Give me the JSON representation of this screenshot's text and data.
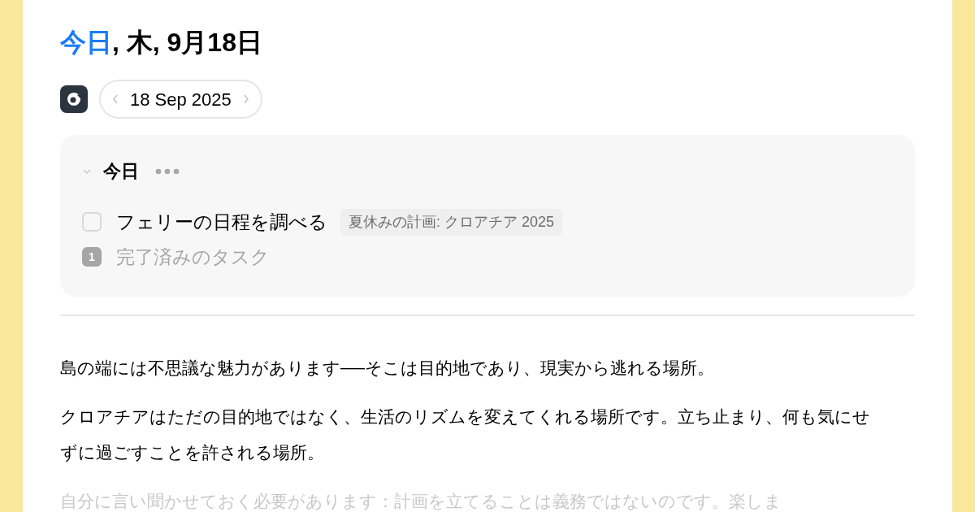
{
  "header": {
    "title_highlight": "今日",
    "title_rest": ", 木, 9月18日",
    "date": "18 Sep 2025"
  },
  "section": {
    "title": "今日",
    "expanded": true,
    "tasks": [
      {
        "title": "フェリーの日程を調べる",
        "checked": false,
        "tag": "夏休みの計画: クロアチア 2025"
      }
    ],
    "completed_count": "1",
    "completed_label": "完了済みのタスク"
  },
  "paragraphs": [
    {
      "text": "島の端には不思議な魅力があります──そこは目的地であり、現実から逃れる場所。",
      "faded": false
    },
    {
      "text": "クロアチアはただの目的地ではなく、生活のリズムを変えてくれる場所です。立ち止まり、何も気にせずに過ごすことを許される場所。",
      "faded": false
    },
    {
      "text": "自分に言い聞かせておく必要があります：計画を立てることは義務ではないのです。楽しま",
      "faded": true
    }
  ]
}
